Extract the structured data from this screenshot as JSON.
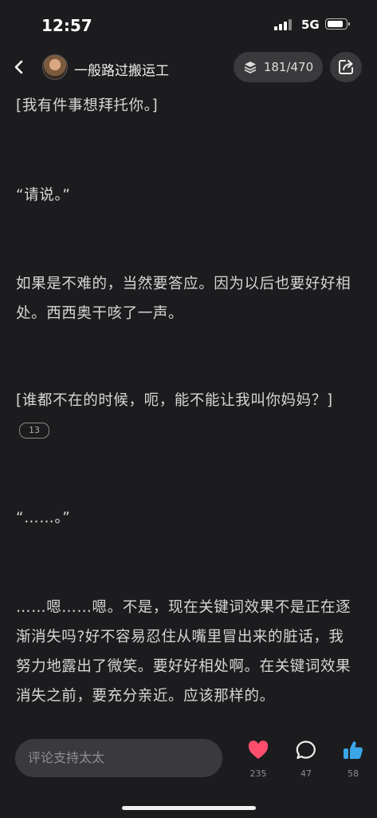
{
  "status_bar": {
    "time": "12:57",
    "network": "5G"
  },
  "header": {
    "author": "一般路过搬运工",
    "progress": "181/470"
  },
  "content": {
    "paragraphs": [
      "[我有件事想拜托你。]",
      "“请说。”",
      "如果是不难的，当然要答应。因为以后也要好好相处。西西奥干咳了一声。",
      "[谁都不在的时候，呃，能不能让我叫你妈妈？]",
      "“……。”",
      "……嗯……嗯。不是，现在关键词效果不是正在逐渐消失吗?好不容易忍住从嘴里冒出来的脏话，我努力地露出了微笑。要好好相处啊。在关键词效果消失之前，要充分亲近。应该那样的。"
    ],
    "comment_badge": "13"
  },
  "bottom_bar": {
    "comment_placeholder": "评论支持太太",
    "like_count": "235",
    "comment_count": "47",
    "thumb_count": "58"
  },
  "colors": {
    "like": "#ff4d6d",
    "thumb": "#3aa6e8",
    "background": "#1c1c1e"
  }
}
